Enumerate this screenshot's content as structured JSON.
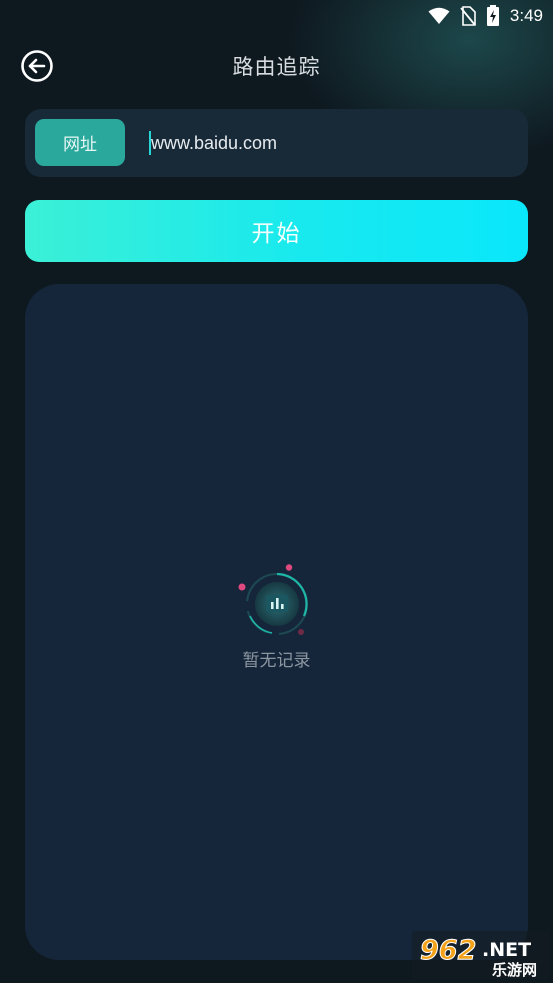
{
  "status_bar": {
    "time": "3:49",
    "icons": [
      "wifi-icon",
      "no-sim-icon",
      "battery-charging-icon"
    ]
  },
  "header": {
    "back_icon": "back-arrow-circle-icon",
    "title": "路由追踪"
  },
  "url_bar": {
    "label": "网址",
    "value": "www.baidu.com"
  },
  "start_button": {
    "label": "开始"
  },
  "results": {
    "empty_icon": "empty-chart-icon",
    "empty_text": "暂无记录"
  },
  "watermark": {
    "logo": "962.NET",
    "sub": "乐游网"
  },
  "colors": {
    "background": "#0e181f",
    "panel": "#16263a",
    "accent_teal": "#2aa89c",
    "accent_cyan": "#0ae7fb",
    "caret": "#27d6d6"
  }
}
